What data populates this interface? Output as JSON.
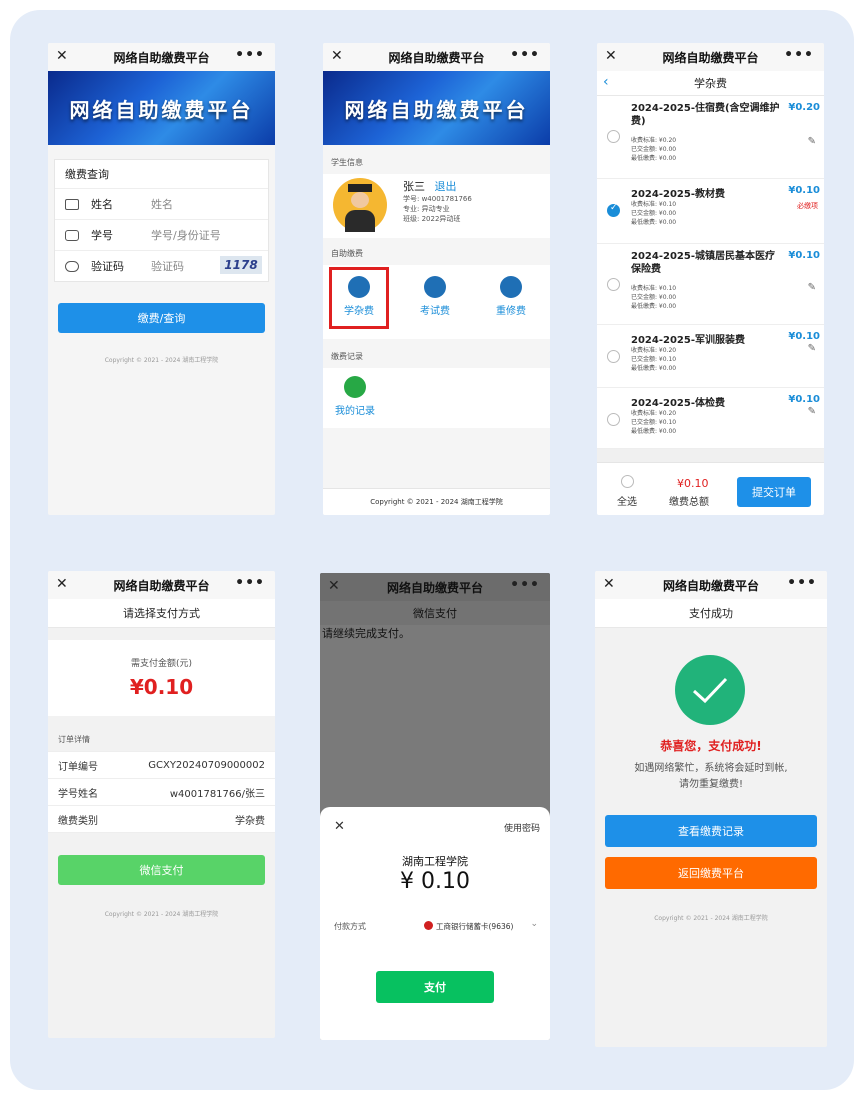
{
  "common": {
    "app_title": "网络自助缴费平台",
    "close_glyph": "✕",
    "more_glyph": "•••",
    "copyright": "Copyright © 2021 - 2024 湖南工程学院"
  },
  "screen1": {
    "banner_text": "网络自助缴费平台",
    "form_title": "缴费查询",
    "fields": [
      {
        "label": "姓名",
        "placeholder": "姓名"
      },
      {
        "label": "学号",
        "placeholder": "学号/身份证号"
      },
      {
        "label": "验证码",
        "placeholder": "验证码"
      }
    ],
    "captcha": "1178",
    "submit_label": "缴费/查询"
  },
  "screen2": {
    "banner_text": "网络自助缴费平台",
    "student_section": "学生信息",
    "student_name": "张三",
    "logout_label": "退出",
    "student_id": "学号: w4001781766",
    "major": "专业: 异动专业",
    "class": "班级: 2022异动班",
    "selfpay_section": "自助缴费",
    "tiles": [
      "学杂费",
      "考试费",
      "重修费"
    ],
    "records_section": "缴费记录",
    "my_records": "我的记录"
  },
  "screen3": {
    "subtitle": "学杂费",
    "items": [
      {
        "title": "2024-2025-住宿费(含空调维护费)",
        "price": "¥0.20",
        "std": "收费标准: ¥0.20",
        "paid": "已交金额: ¥0.00",
        "min": "最低缴费: ¥0.00",
        "checked": false,
        "required": ""
      },
      {
        "title": "2024-2025-教材费",
        "price": "¥0.10",
        "std": "收费标准: ¥0.10",
        "paid": "已交金额: ¥0.00",
        "min": "最低缴费: ¥0.00",
        "checked": true,
        "required": "必缴项"
      },
      {
        "title": "2024-2025-城镇居民基本医疗保险费",
        "price": "¥0.10",
        "std": "收费标准: ¥0.10",
        "paid": "已交金额: ¥0.00",
        "min": "最低缴费: ¥0.00",
        "checked": false,
        "required": ""
      },
      {
        "title": "2024-2025-军训服装费",
        "price": "¥0.10",
        "std": "收费标准: ¥0.20",
        "paid": "已交金额: ¥0.10",
        "min": "最低缴费: ¥0.00",
        "checked": false,
        "required": ""
      },
      {
        "title": "2024-2025-体检费",
        "price": "¥0.10",
        "std": "收费标准: ¥0.20",
        "paid": "已交金额: ¥0.10",
        "min": "最低缴费: ¥0.00",
        "checked": false,
        "required": ""
      }
    ],
    "select_all": "全选",
    "total_amount": "¥0.10",
    "total_label": "缴费总额",
    "submit_label": "提交订单"
  },
  "screen4": {
    "subtitle": "请选择支付方式",
    "amount_label": "需支付金额(元)",
    "amount": "¥0.10",
    "details_section": "订单详情",
    "rows": [
      {
        "k": "订单编号",
        "v": "GCXY20240709000002"
      },
      {
        "k": "学号姓名",
        "v": "w4001781766/张三"
      },
      {
        "k": "缴费类别",
        "v": "学杂费"
      }
    ],
    "pay_label": "微信支付"
  },
  "screen5": {
    "subtitle": "微信支付",
    "continue_text": "请继续完成支付。",
    "use_password": "使用密码",
    "merchant": "湖南工程学院",
    "amount": "¥ 0.10",
    "method_label": "付款方式",
    "method_value": "工商银行储蓄卡(9636)",
    "pay_label": "支付"
  },
  "screen6": {
    "subtitle": "支付成功",
    "success_title": "恭喜您，支付成功!",
    "note_line1": "如遇网络繁忙，系统将会延时到帐,",
    "note_line2": "请勿重复缴费!",
    "view_records": "查看缴费记录",
    "back_home": "返回缴费平台"
  },
  "colors": {
    "accent_blue": "#1a8dd8",
    "green": "#07c160",
    "red": "#e02020",
    "orange": "#ff6a00"
  }
}
